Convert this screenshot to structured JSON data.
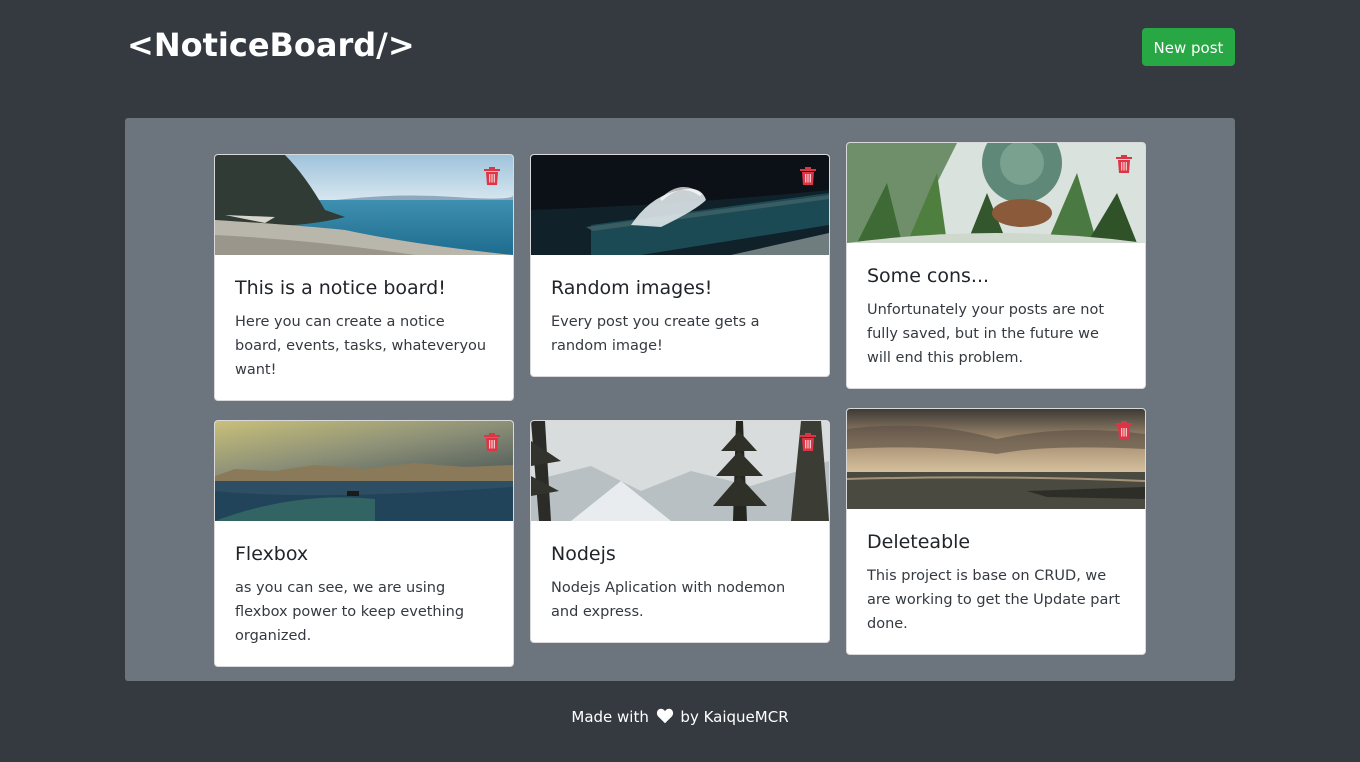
{
  "header": {
    "brand": "<NoticeBoard/>",
    "new_post_label": "New post"
  },
  "colors": {
    "background": "#343a40",
    "board": "#6c757d",
    "primary_button": "#28a745",
    "delete_icon": "#dc3545"
  },
  "cards": [
    {
      "title": "This is a notice board!",
      "text": "Here you can create a notice board, events, tasks, whateveryou want!",
      "image": "coast-beach"
    },
    {
      "title": "Random images!",
      "text": "Every post you create gets a random image!",
      "image": "sea-pool-wave"
    },
    {
      "title": "Some cons...",
      "text": "Unfortunately your posts are not fully saved, but in the future we will end this problem.",
      "image": "succulents"
    },
    {
      "title": "Flexbox",
      "text": "as you can see, we are using flexbox power to keep evething organized.",
      "image": "harbor-city"
    },
    {
      "title": "Nodejs",
      "text": "Nodejs Aplication with nodemon and express.",
      "image": "snowy-forest"
    },
    {
      "title": "Deleteable",
      "text": "This project is base on CRUD, we are working to get the Update part done.",
      "image": "ocean-sunset"
    }
  ],
  "footer": {
    "made_with": "Made with",
    "by": "by KaiqueMCR",
    "heart_icon": "heart-icon"
  }
}
